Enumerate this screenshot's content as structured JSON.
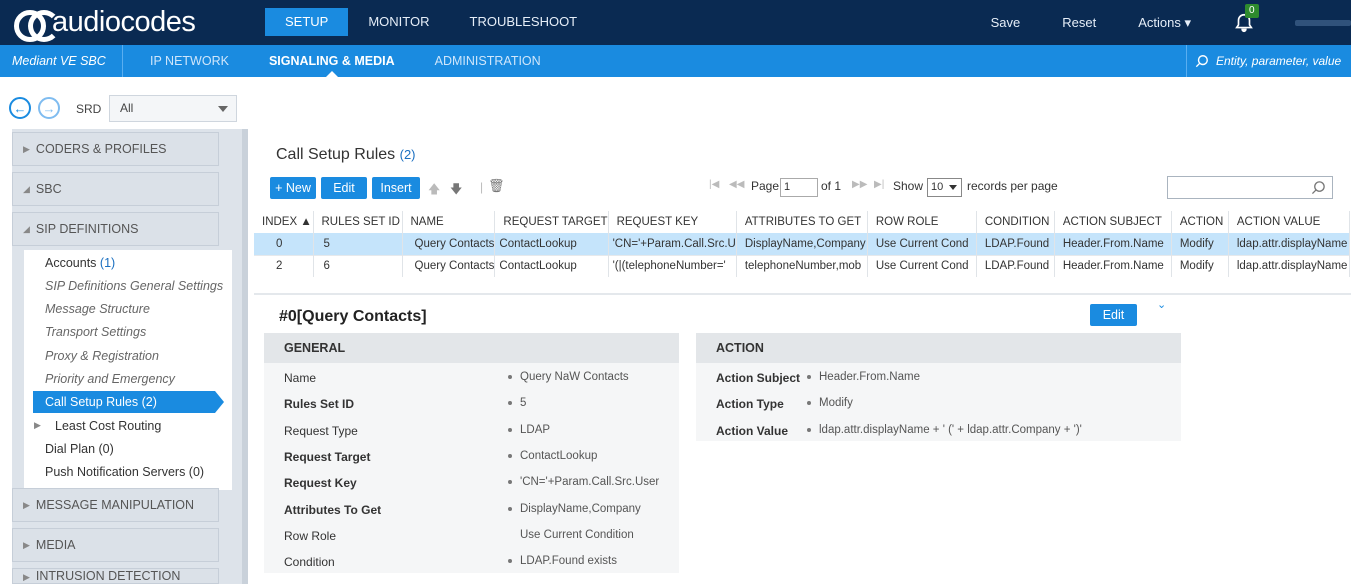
{
  "top": {
    "logo": "audiocodes",
    "tabs": [
      "SETUP",
      "MONITOR",
      "TROUBLESHOOT"
    ],
    "actions": [
      "Save",
      "Reset",
      "Actions ▾"
    ],
    "bell_count": "0"
  },
  "sub": {
    "device": "Mediant VE SBC",
    "tabs": [
      "IP NETWORK",
      "SIGNALING & MEDIA",
      "ADMINISTRATION"
    ],
    "search_placeholder": "Entity, parameter, value"
  },
  "srd": {
    "label": "SRD",
    "value": "All"
  },
  "nav": {
    "sections": [
      "CODERS & PROFILES",
      "SBC",
      "SIP DEFINITIONS",
      "MESSAGE MANIPULATION",
      "MEDIA",
      "INTRUSION DETECTION"
    ],
    "items": [
      {
        "label": "Accounts",
        "count": "(1)"
      },
      {
        "label": "SIP Definitions General Settings"
      },
      {
        "label": "Message Structure"
      },
      {
        "label": "Transport Settings"
      },
      {
        "label": "Proxy & Registration"
      },
      {
        "label": "Priority and Emergency"
      },
      {
        "label": "Call Setup Rules (2)"
      },
      {
        "label": "Least Cost Routing"
      },
      {
        "label": "Dial Plan (0)"
      },
      {
        "label": "Push Notification Servers (0)"
      }
    ]
  },
  "page": {
    "title": "Call Setup Rules",
    "count": "(2)",
    "buttons": [
      "+ New",
      "Edit",
      "Insert"
    ],
    "page_label": "Page",
    "page_value": "1",
    "of_label": "of 1",
    "show_label": "Show",
    "show_value": "10",
    "records_label": "records per page"
  },
  "table": {
    "columns": [
      "INDEX ▲",
      "RULES SET ID",
      "NAME",
      "REQUEST TARGET",
      "REQUEST KEY",
      "ATTRIBUTES TO GET",
      "ROW ROLE",
      "CONDITION",
      "ACTION SUBJECT",
      "ACTION",
      "ACTION VALUE"
    ],
    "rows": [
      [
        "0",
        "5",
        "Query Contacts",
        "ContactLookup",
        "'CN='+Param.Call.Src.U",
        "DisplayName,Company",
        "Use Current Cond",
        "LDAP.Found",
        "Header.From.Name",
        "Modify",
        "ldap.attr.displayName"
      ],
      [
        "2",
        "6",
        "Query Contacts",
        "ContactLookup",
        "'(|(telephoneNumber='",
        "telephoneNumber,mob",
        "Use Current Cond",
        "LDAP.Found",
        "Header.From.Name",
        "Modify",
        "ldap.attr.displayName"
      ]
    ]
  },
  "detail": {
    "title": "#0[Query Contacts]",
    "edit": "Edit",
    "general_header": "GENERAL",
    "general": [
      {
        "label": "Name",
        "value": "Query NaW Contacts"
      },
      {
        "label": "Rules Set ID",
        "value": "5"
      },
      {
        "label": "Request Type",
        "value": "LDAP"
      },
      {
        "label": "Request Target",
        "value": "ContactLookup"
      },
      {
        "label": "Request Key",
        "value": "'CN='+Param.Call.Src.User"
      },
      {
        "label": "Attributes To Get",
        "value": "DisplayName,Company"
      },
      {
        "label": "Row Role",
        "value": "Use Current Condition"
      },
      {
        "label": "Condition",
        "value": "LDAP.Found exists"
      }
    ],
    "action_header": "ACTION",
    "action": [
      {
        "label": "Action Subject",
        "value": "Header.From.Name"
      },
      {
        "label": "Action Type",
        "value": "Modify"
      },
      {
        "label": "Action Value",
        "value": "ldap.attr.displayName + ' (' + ldap.attr.Company + ')'"
      }
    ]
  }
}
